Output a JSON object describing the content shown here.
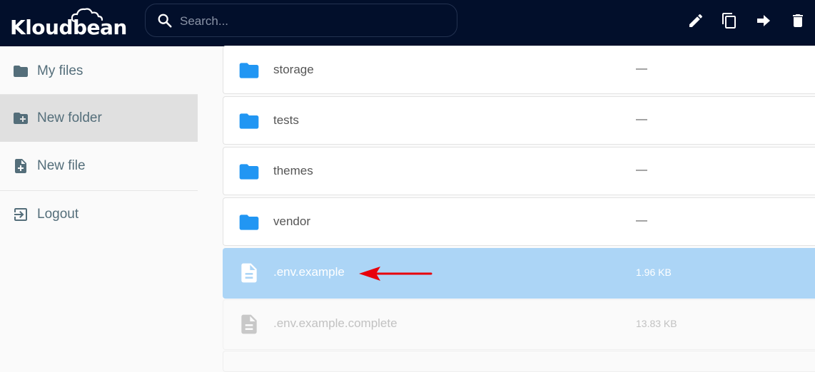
{
  "header": {
    "logo_text": "Kloudbean",
    "search_placeholder": "Search...",
    "actions": [
      {
        "name": "rename",
        "icon": "pencil-icon"
      },
      {
        "name": "copy",
        "icon": "copy-icon"
      },
      {
        "name": "move",
        "icon": "arrow-right-icon"
      },
      {
        "name": "delete",
        "icon": "trash-icon"
      }
    ]
  },
  "sidebar": {
    "items": [
      {
        "label": "My files",
        "icon": "folder-icon",
        "active": false
      },
      {
        "label": "New folder",
        "icon": "folder-plus-icon",
        "active": true
      },
      {
        "label": "New file",
        "icon": "file-plus-icon",
        "active": false
      },
      {
        "label": "Logout",
        "icon": "logout-icon",
        "active": false
      }
    ]
  },
  "files": [
    {
      "name": "storage",
      "size": "—",
      "type": "folder"
    },
    {
      "name": "tests",
      "size": "—",
      "type": "folder"
    },
    {
      "name": "themes",
      "size": "—",
      "type": "folder"
    },
    {
      "name": "vendor",
      "size": "—",
      "type": "folder"
    },
    {
      "name": ".env.example",
      "size": "1.96 KB",
      "type": "file",
      "selected": true
    },
    {
      "name": ".env.example.complete",
      "size": "13.83 KB",
      "type": "file",
      "faded": true
    }
  ],
  "colors": {
    "header_bg": "#020f2b",
    "folder_blue": "#2196f3",
    "selected_bg": "#acd5f6",
    "annotation_arrow": "#e8000b",
    "sidebar_text": "#546e7a"
  }
}
